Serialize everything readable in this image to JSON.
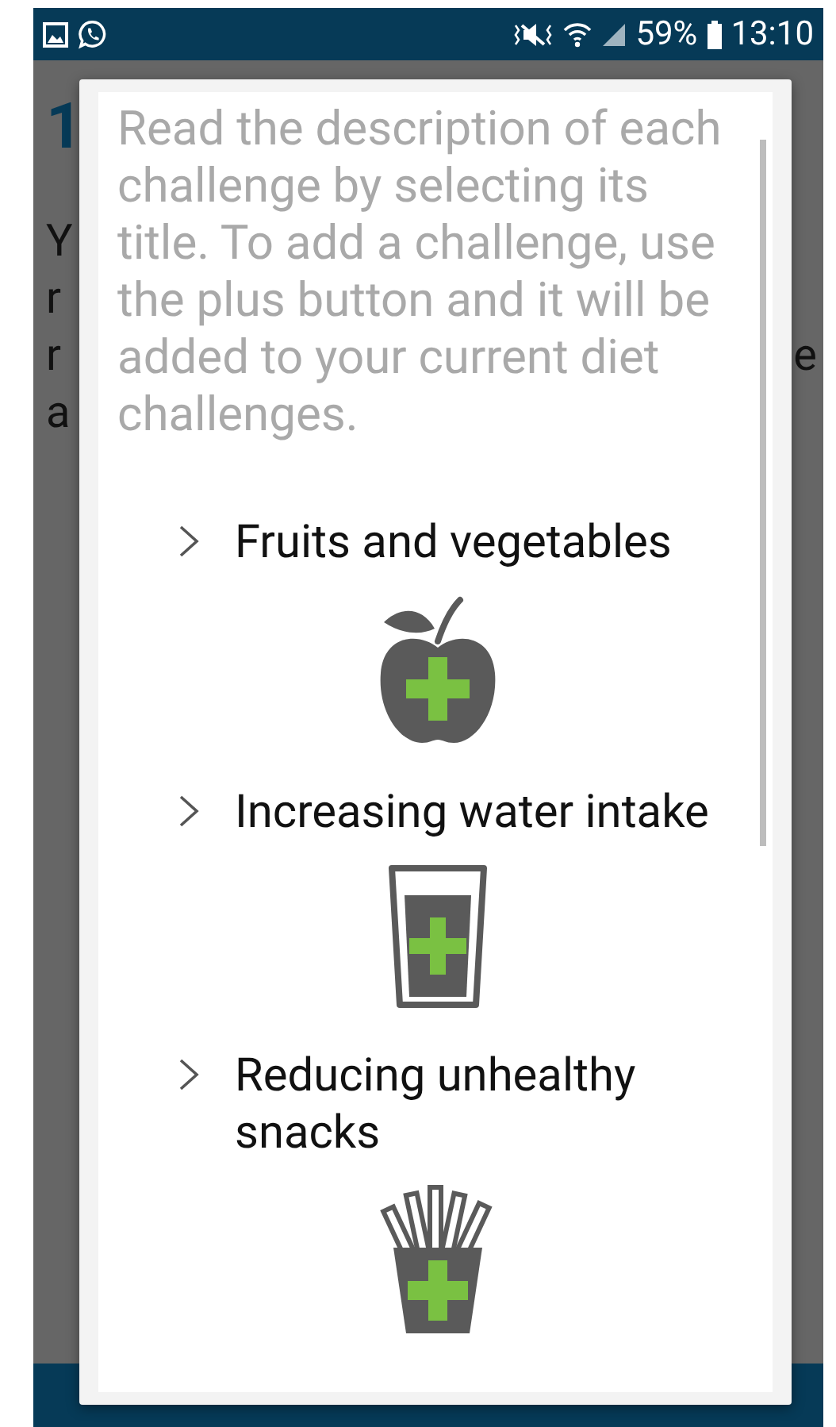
{
  "status_bar": {
    "battery": "59%",
    "time": "13:10"
  },
  "background": {
    "heading": "1",
    "lines": [
      {
        "start": "Y"
      },
      {
        "start": "r"
      },
      {
        "start": "r",
        "end": "e"
      },
      {
        "start": "a"
      }
    ]
  },
  "dialog": {
    "intro": "Read the description of each challenge by selecting its title. To add a challenge, use the plus button and it will be added to your current diet challenges.",
    "challenges": [
      {
        "title": "Fruits and vegetables",
        "kind": "fruit",
        "expanded": false
      },
      {
        "title": "Increasing water intake",
        "kind": "water",
        "expanded": false
      },
      {
        "title": "Reducing unhealthy snacks",
        "kind": "snacks",
        "expanded": false
      }
    ]
  }
}
